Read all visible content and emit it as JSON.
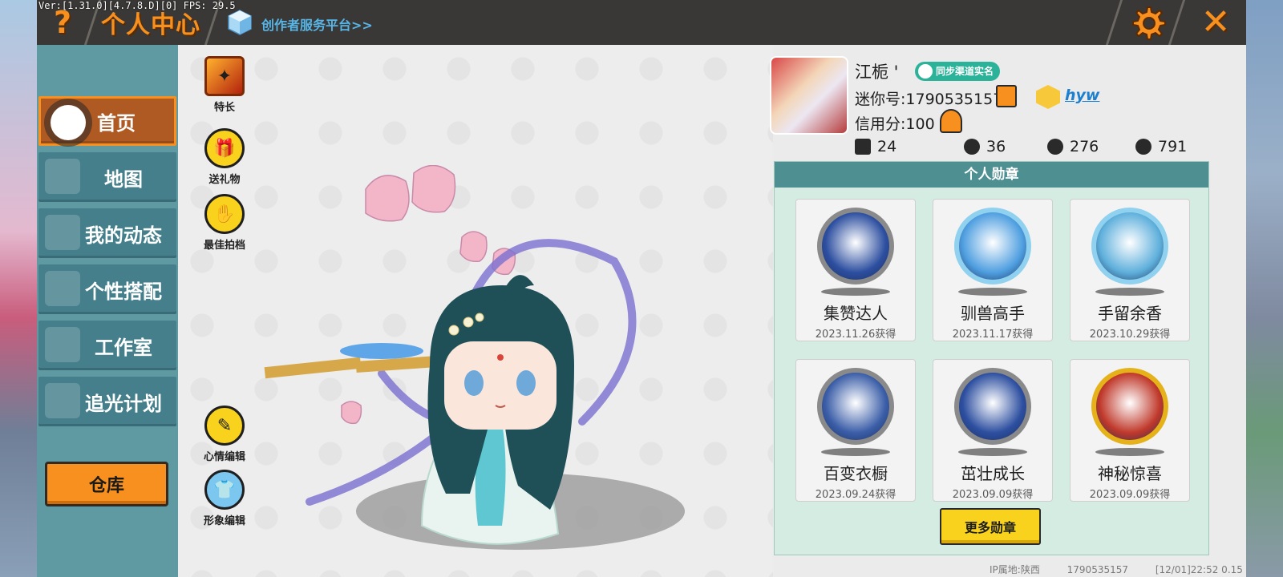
{
  "debug": {
    "version_fps": "Ver:[1.31.0][4.7.8.D][0] FPS: 29.5"
  },
  "header": {
    "help_label": "?",
    "title": "个人中心",
    "creator_link": "创作者服务平台>>",
    "close_label": "✕"
  },
  "sidebar": {
    "items": [
      {
        "label": "首页",
        "active": true
      },
      {
        "label": "地图",
        "active": false
      },
      {
        "label": "我的动态",
        "active": false
      },
      {
        "label": "个性搭配",
        "active": false
      },
      {
        "label": "工作室",
        "active": false
      },
      {
        "label": "追光计划",
        "active": false
      }
    ],
    "warehouse_label": "仓库"
  },
  "stage_tools": {
    "top": [
      {
        "label": "特长",
        "icon": "skill-icon"
      },
      {
        "label": "送礼物",
        "icon": "gift-icon"
      },
      {
        "label": "最佳拍档",
        "icon": "handshake-icon"
      }
    ],
    "bottom": [
      {
        "label": "心情编辑",
        "icon": "edit-icon"
      },
      {
        "label": "形象编辑",
        "icon": "outfit-icon"
      }
    ]
  },
  "profile": {
    "nickname": "江栀 '",
    "sync_badge": "同步渠道实名",
    "mini_id": "迷你号:1790535157",
    "team_name": "hyw",
    "credit": "信用分:100",
    "stats": {
      "likes": "24",
      "fans": "36",
      "heat": "276",
      "hearts": "791"
    }
  },
  "medals": {
    "header": "个人勋章",
    "items": [
      {
        "name": "集赞达人",
        "date": "2023.11.26获得",
        "ring": "#8a8a8a",
        "fill": "#2d4fa0"
      },
      {
        "name": "驯兽高手",
        "date": "2023.11.17获得",
        "ring": "#8fd1ee",
        "fill": "#4f9fe0"
      },
      {
        "name": "手留余香",
        "date": "2023.10.29获得",
        "ring": "#8fd1ee",
        "fill": "#5fb0dc"
      },
      {
        "name": "百变衣橱",
        "date": "2023.09.24获得",
        "ring": "#8a8a8a",
        "fill": "#3b5ea8"
      },
      {
        "name": "茁壮成长",
        "date": "2023.09.09获得",
        "ring": "#8a8a8a",
        "fill": "#2d4fa0"
      },
      {
        "name": "神秘惊喜",
        "date": "2023.09.09获得",
        "ring": "#e5b21a",
        "fill": "#c0392b"
      }
    ],
    "more_label": "更多勋章"
  },
  "footer": {
    "ip_location": "IP属地:陕西",
    "uid": "1790535157",
    "time": "[12/01]22:52 0.15"
  },
  "colors": {
    "accent_orange": "#f7901e",
    "sidebar_teal": "#447f8b",
    "medal_panel": "#d4ece1",
    "button_yellow": "#f8d21c"
  }
}
